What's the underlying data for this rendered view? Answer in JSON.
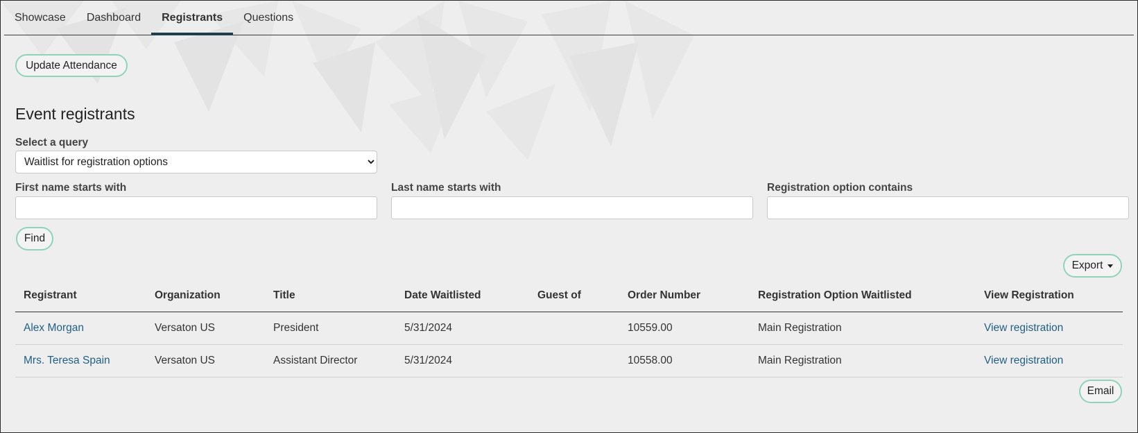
{
  "tabs": [
    "Showcase",
    "Dashboard",
    "Registrants",
    "Questions"
  ],
  "active_tab": "Registrants",
  "update_attendance_label": "Update Attendance",
  "section_title": "Event registrants",
  "query": {
    "label": "Select a query",
    "selected": "Waitlist for registration options"
  },
  "filters": {
    "first_name_label": "First name starts with",
    "first_name_value": "",
    "last_name_label": "Last name starts with",
    "last_name_value": "",
    "option_label": "Registration option contains",
    "option_value": ""
  },
  "find_label": "Find",
  "export_label": "Export",
  "email_label": "Email",
  "table": {
    "columns": [
      "Registrant",
      "Organization",
      "Title",
      "Date Waitlisted",
      "Guest of",
      "Order Number",
      "Registration Option Waitlisted",
      "View Registration"
    ],
    "rows": [
      {
        "registrant": "Alex Morgan",
        "organization": "Versaton US",
        "title": "President",
        "date": "5/31/2024",
        "guest_of": "",
        "order": "10559.00",
        "option": "Main Registration",
        "view": "View registration"
      },
      {
        "registrant": "Mrs. Teresa Spain",
        "organization": "Versaton US",
        "title": "Assistant Director",
        "date": "5/31/2024",
        "guest_of": "",
        "order": "10558.00",
        "option": "Main Registration",
        "view": "View registration"
      }
    ]
  },
  "colors": {
    "accent_border": "#8fd3b8",
    "link": "#1f5f85",
    "tab_underline": "#1e3d4d",
    "background": "#eeeeee"
  },
  "icons": {
    "export_caret": "caret-down-icon",
    "select_arrow": "chevron-down-icon"
  }
}
